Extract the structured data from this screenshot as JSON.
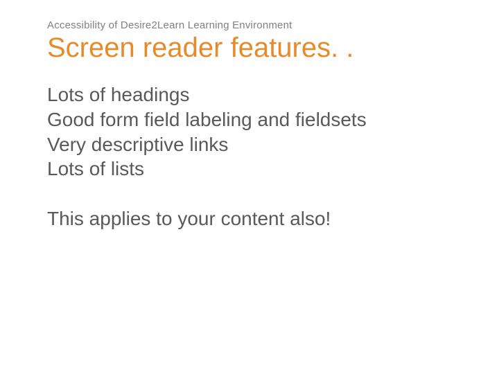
{
  "breadcrumb": "Accessibility of Desire2Learn Learning Environment",
  "title": "Screen reader features. .",
  "bullets": [
    "Lots of headings",
    "Good form field labeling and fieldsets",
    "Very descriptive links",
    "Lots of lists"
  ],
  "footer": "This applies to your content also!"
}
